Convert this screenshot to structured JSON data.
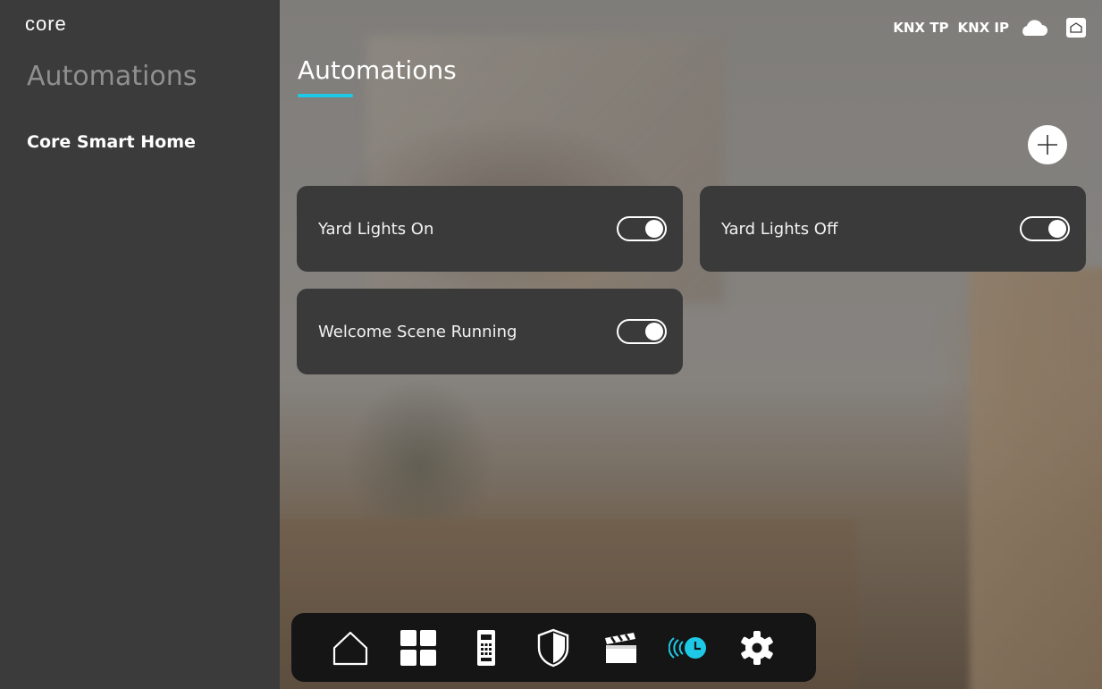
{
  "app": {
    "logo": "core"
  },
  "sidebar": {
    "title": "Automations",
    "items": [
      {
        "label": "Core Smart Home"
      }
    ]
  },
  "header": {
    "title": "Automations",
    "accent_color": "#1ec9e6",
    "status": [
      {
        "label": "KNX TP"
      },
      {
        "label": "KNX IP"
      }
    ],
    "icons": [
      "cloud-icon",
      "home-status-icon"
    ]
  },
  "actions": {
    "add_icon": "plus-icon"
  },
  "automations": [
    {
      "label": "Yard Lights On",
      "enabled": true
    },
    {
      "label": "Yard Lights Off",
      "enabled": true
    },
    {
      "label": "Welcome Scene Running",
      "enabled": true
    }
  ],
  "bottom_nav": {
    "items": [
      {
        "icon": "home-icon",
        "active": false
      },
      {
        "icon": "rooms-grid-icon",
        "active": false
      },
      {
        "icon": "intercom-icon",
        "active": false
      },
      {
        "icon": "security-shield-icon",
        "active": false
      },
      {
        "icon": "scenes-clapper-icon",
        "active": false
      },
      {
        "icon": "automation-clock-icon",
        "active": true
      },
      {
        "icon": "settings-gear-icon",
        "active": false
      }
    ]
  }
}
